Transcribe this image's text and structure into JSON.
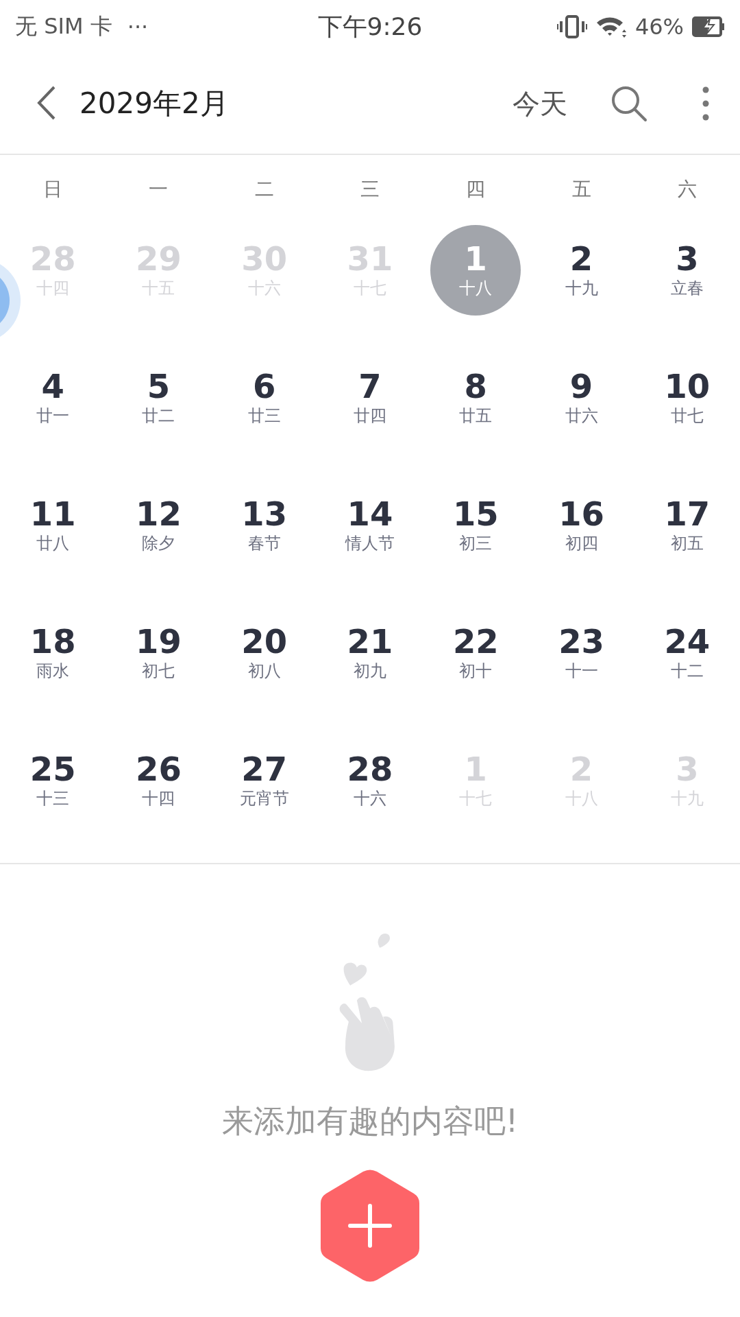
{
  "status_bar": {
    "carrier": "无 SIM 卡",
    "more": "···",
    "time": "下午9:26",
    "battery": "46%"
  },
  "header": {
    "title": "2029年2月",
    "today": "今天"
  },
  "weekdays": [
    "日",
    "一",
    "二",
    "三",
    "四",
    "五",
    "六"
  ],
  "weeks": [
    [
      {
        "day": "28",
        "lunar": "十四",
        "outside": true,
        "selected": false
      },
      {
        "day": "29",
        "lunar": "十五",
        "outside": true,
        "selected": false
      },
      {
        "day": "30",
        "lunar": "十六",
        "outside": true,
        "selected": false
      },
      {
        "day": "31",
        "lunar": "十七",
        "outside": true,
        "selected": false
      },
      {
        "day": "1",
        "lunar": "十八",
        "outside": false,
        "selected": true
      },
      {
        "day": "2",
        "lunar": "十九",
        "outside": false,
        "selected": false
      },
      {
        "day": "3",
        "lunar": "立春",
        "outside": false,
        "selected": false
      }
    ],
    [
      {
        "day": "4",
        "lunar": "廿一",
        "outside": false,
        "selected": false
      },
      {
        "day": "5",
        "lunar": "廿二",
        "outside": false,
        "selected": false
      },
      {
        "day": "6",
        "lunar": "廿三",
        "outside": false,
        "selected": false
      },
      {
        "day": "7",
        "lunar": "廿四",
        "outside": false,
        "selected": false
      },
      {
        "day": "8",
        "lunar": "廿五",
        "outside": false,
        "selected": false
      },
      {
        "day": "9",
        "lunar": "廿六",
        "outside": false,
        "selected": false
      },
      {
        "day": "10",
        "lunar": "廿七",
        "outside": false,
        "selected": false
      }
    ],
    [
      {
        "day": "11",
        "lunar": "廿八",
        "outside": false,
        "selected": false
      },
      {
        "day": "12",
        "lunar": "除夕",
        "outside": false,
        "selected": false
      },
      {
        "day": "13",
        "lunar": "春节",
        "outside": false,
        "selected": false
      },
      {
        "day": "14",
        "lunar": "情人节",
        "outside": false,
        "selected": false
      },
      {
        "day": "15",
        "lunar": "初三",
        "outside": false,
        "selected": false
      },
      {
        "day": "16",
        "lunar": "初四",
        "outside": false,
        "selected": false
      },
      {
        "day": "17",
        "lunar": "初五",
        "outside": false,
        "selected": false
      }
    ],
    [
      {
        "day": "18",
        "lunar": "雨水",
        "outside": false,
        "selected": false
      },
      {
        "day": "19",
        "lunar": "初七",
        "outside": false,
        "selected": false
      },
      {
        "day": "20",
        "lunar": "初八",
        "outside": false,
        "selected": false
      },
      {
        "day": "21",
        "lunar": "初九",
        "outside": false,
        "selected": false
      },
      {
        "day": "22",
        "lunar": "初十",
        "outside": false,
        "selected": false
      },
      {
        "day": "23",
        "lunar": "十一",
        "outside": false,
        "selected": false
      },
      {
        "day": "24",
        "lunar": "十二",
        "outside": false,
        "selected": false
      }
    ],
    [
      {
        "day": "25",
        "lunar": "十三",
        "outside": false,
        "selected": false
      },
      {
        "day": "26",
        "lunar": "十四",
        "outside": false,
        "selected": false
      },
      {
        "day": "27",
        "lunar": "元宵节",
        "outside": false,
        "selected": false
      },
      {
        "day": "28",
        "lunar": "十六",
        "outside": false,
        "selected": false
      },
      {
        "day": "1",
        "lunar": "十七",
        "outside": true,
        "selected": false
      },
      {
        "day": "2",
        "lunar": "十八",
        "outside": true,
        "selected": false
      },
      {
        "day": "3",
        "lunar": "十九",
        "outside": true,
        "selected": false
      }
    ]
  ],
  "empty_state": {
    "message": "来添加有趣的内容吧!"
  }
}
